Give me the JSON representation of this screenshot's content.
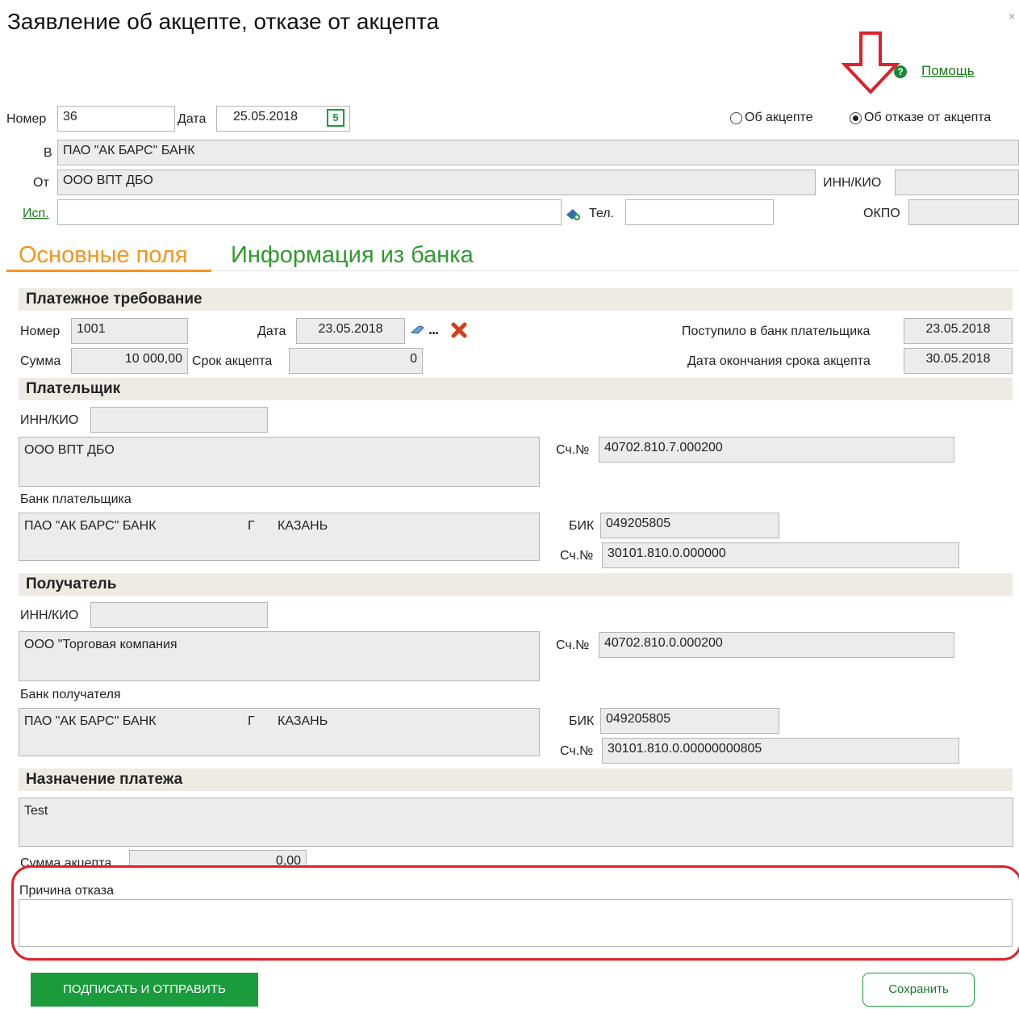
{
  "title": "Заявление об акцепте, отказе от акцепта",
  "help_label": "Помощь",
  "header": {
    "number_label": "Номер",
    "number_value": "36",
    "date_label": "Дата",
    "date_value": "25.05.2018",
    "radio_accept": "Об акцепте",
    "radio_refuse": "Об отказе от акцепта",
    "to_label": "В",
    "to_value": "ПАО \"АК БАРС\" БАНК",
    "from_label": "От",
    "from_value": "ООО ВПТ ДБО",
    "inn_label": "ИНН/КИО",
    "inn_value": "",
    "executor_label": "Исп.",
    "executor_value": "",
    "phone_label": "Тел.",
    "phone_value": "",
    "okpo_label": "ОКПО",
    "okpo_value": ""
  },
  "tabs": {
    "main": "Основные поля",
    "bank": "Информация из банка"
  },
  "payment_request": {
    "section_title": "Платежное требование",
    "number_label": "Номер",
    "number_value": "1001",
    "date_label": "Дата",
    "date_value": "23.05.2018",
    "sum_label": "Сумма",
    "sum_value": "10 000,00",
    "term_label": "Срок акцепта",
    "term_value": "0",
    "received_label": "Поступило в банк плательщика",
    "received_value": "23.05.2018",
    "end_label": "Дата окончания срока акцепта",
    "end_value": "30.05.2018"
  },
  "payer": {
    "section_title": "Плательщик",
    "inn_label": "ИНН/КИО",
    "inn_value": "",
    "name": "ООО ВПТ ДБО",
    "account_label": "Сч.№",
    "account_value": "40702.810.7.000200",
    "bank_label": "Банк плательщика",
    "bank_name": "ПАО \"АК БАРС\" БАНК",
    "bank_city_prefix": "Г",
    "bank_city": "КАЗАНЬ",
    "bik_label": "БИК",
    "bik_value": "049205805",
    "corr_label": "Сч.№",
    "corr_value": "30101.810.0.000000"
  },
  "recipient": {
    "section_title": "Получатель",
    "inn_label": "ИНН/КИО",
    "inn_value": "",
    "name": "ООО \"Торговая компания",
    "account_label": "Сч.№",
    "account_value": "40702.810.0.000200",
    "bank_label": "Банк получателя",
    "bank_name": "ПАО \"АК БАРС\" БАНК",
    "bank_city_prefix": "Г",
    "bank_city": "КАЗАНЬ",
    "bik_label": "БИК",
    "bik_value": "049205805",
    "corr_label": "Сч.№",
    "corr_value": "30101.810.0.00000000805"
  },
  "purpose": {
    "section_title": "Назначение платежа",
    "value": "Test",
    "accept_sum_label": "Сумма акцепта",
    "accept_sum_value": "0,00"
  },
  "refusal": {
    "label": "Причина отказа",
    "value": ""
  },
  "buttons": {
    "sign_send": "ПОДПИСАТЬ И ОТПРАВИТЬ",
    "save": "Сохранить"
  },
  "colors": {
    "green": "#1a9b3c",
    "tab_active": "#f7941d",
    "tab_inactive": "#2e9a2e",
    "annotation_red": "#e0202a"
  }
}
